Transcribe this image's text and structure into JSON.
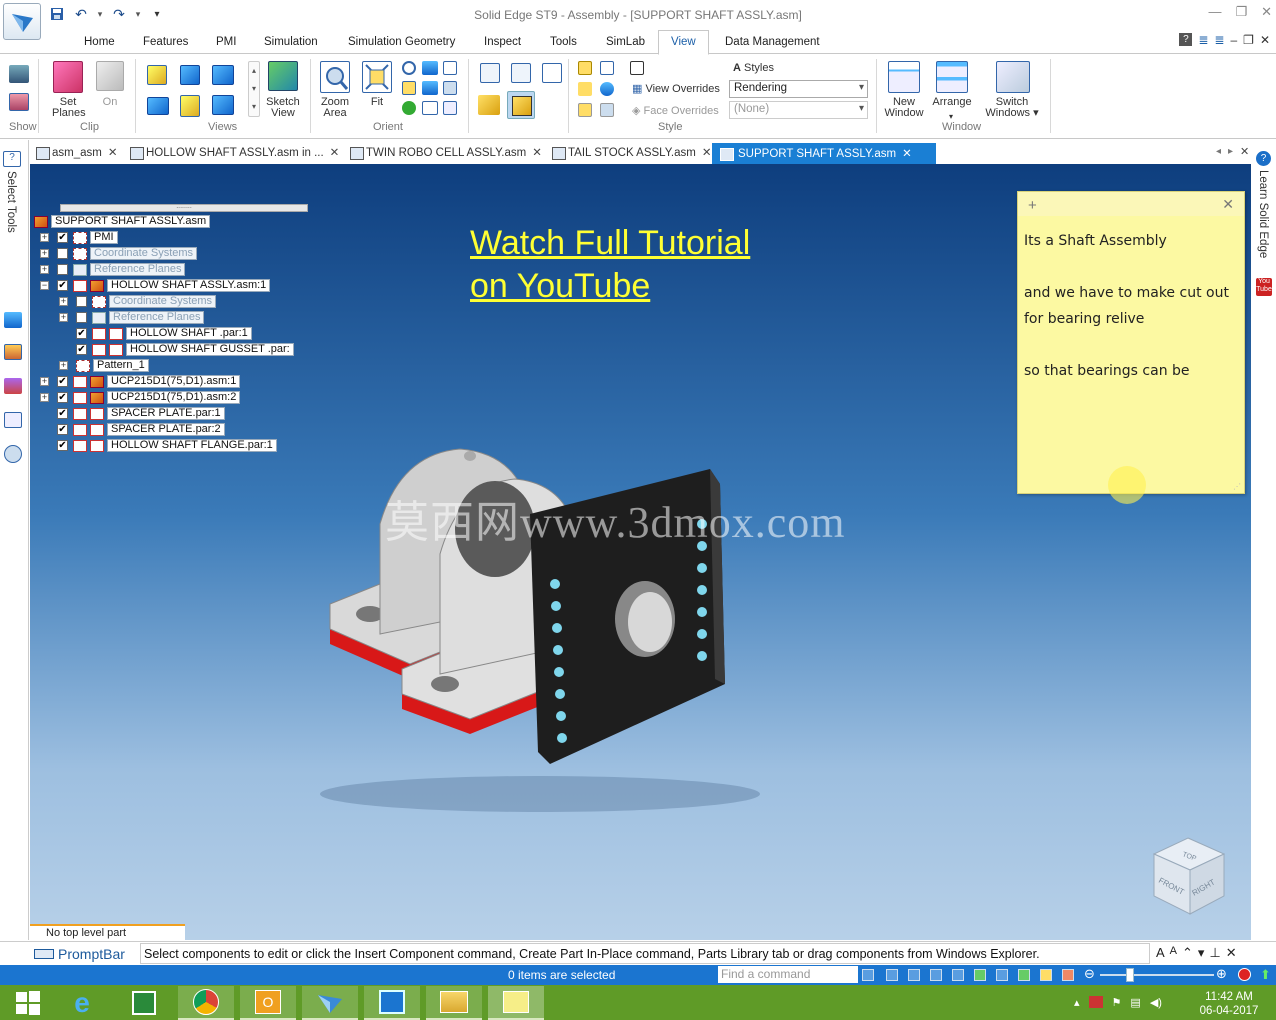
{
  "window": {
    "title": "Solid Edge ST9 - Assembly - [SUPPORT SHAFT ASSLY.asm]"
  },
  "ribbon_tabs": [
    "Home",
    "Features",
    "PMI",
    "Simulation",
    "Simulation Geometry",
    "Inspect",
    "Tools",
    "SimLab",
    "View",
    "Data Management"
  ],
  "active_tab": "View",
  "ribbon": {
    "show_label": "Show",
    "set_planes": "Set",
    "set_planes2": "Planes",
    "on_label": "On",
    "clip_group": "Clip",
    "views_group": "Views",
    "sketch_view": "Sketch",
    "sketch_view2": "View",
    "zoom_area": "Zoom",
    "zoom_area2": "Area",
    "fit": "Fit",
    "orient_group": "Orient",
    "styles": "Styles",
    "view_overrides": "View Overrides",
    "view_overrides_value": "Rendering",
    "face_overrides": "Face Overrides",
    "face_overrides_value": "(None)",
    "style_group": "Style",
    "new_window": "New",
    "new_window2": "Window",
    "arrange": "Arrange",
    "switch_windows": "Switch",
    "switch_windows2": "Windows",
    "window_group": "Window"
  },
  "doc_tabs": [
    {
      "label": "asm_asm"
    },
    {
      "label": "HOLLOW SHAFT ASSLY.asm in ..."
    },
    {
      "label": "TWIN ROBO CELL  ASSLY.asm"
    },
    {
      "label": "TAIL STOCK ASSLY.asm"
    },
    {
      "label": "SUPPORT SHAFT ASSLY.asm"
    }
  ],
  "left_panel": {
    "select_tools": "Select Tools"
  },
  "right_panel": {
    "learn": "Learn Solid Edge"
  },
  "tree": {
    "handle": "........",
    "nodes": [
      {
        "label": "SUPPORT SHAFT ASSLY.asm"
      },
      {
        "label": "PMI"
      },
      {
        "label": "Coordinate Systems"
      },
      {
        "label": "Reference Planes"
      },
      {
        "label": "HOLLOW SHAFT ASSLY.asm:1"
      },
      {
        "label": "Coordinate Systems"
      },
      {
        "label": "Reference Planes"
      },
      {
        "label": "HOLLOW SHAFT .par:1"
      },
      {
        "label": "HOLLOW SHAFT GUSSET .par:"
      },
      {
        "label": "Pattern_1"
      },
      {
        "label": "UCP215D1(75,D1).asm:1"
      },
      {
        "label": "UCP215D1(75,D1).asm:2"
      },
      {
        "label": "SPACER PLATE.par:1"
      },
      {
        "label": "SPACER PLATE.par:2"
      },
      {
        "label": "HOLLOW SHAFT FLANGE.par:1"
      }
    ]
  },
  "overlay": {
    "line1": "Watch Full Tutorial ",
    "line2": "on YouTube",
    "watermark": "莫西网www.3dmox.com"
  },
  "note": {
    "line1": "Its a Shaft Assembly",
    "line2": "and we have to make cut out for bearing relive",
    "line3": "so that bearings can be"
  },
  "viewcube": {
    "top": "TOP",
    "front": "FRONT",
    "right": "RIGHT"
  },
  "status_part": "No top level part selected",
  "promptbar": {
    "label": "PromptBar",
    "text": "Select components to edit or click the Insert Component command, Create Part In-Place command, Parts Library tab or drag components from Windows Explorer."
  },
  "statusbar": {
    "selection": "0 items are selected",
    "find_placeholder": "Find a command"
  },
  "taskbar": {
    "time": "11:42 AM",
    "date": "06-04-2017"
  },
  "colors": {
    "accent": "#1a7fd4",
    "statusbar": "#1b75d0",
    "taskbar": "#5f9b27",
    "overlay_text": "#ffff33",
    "note_bg": "#fcf9a2"
  }
}
